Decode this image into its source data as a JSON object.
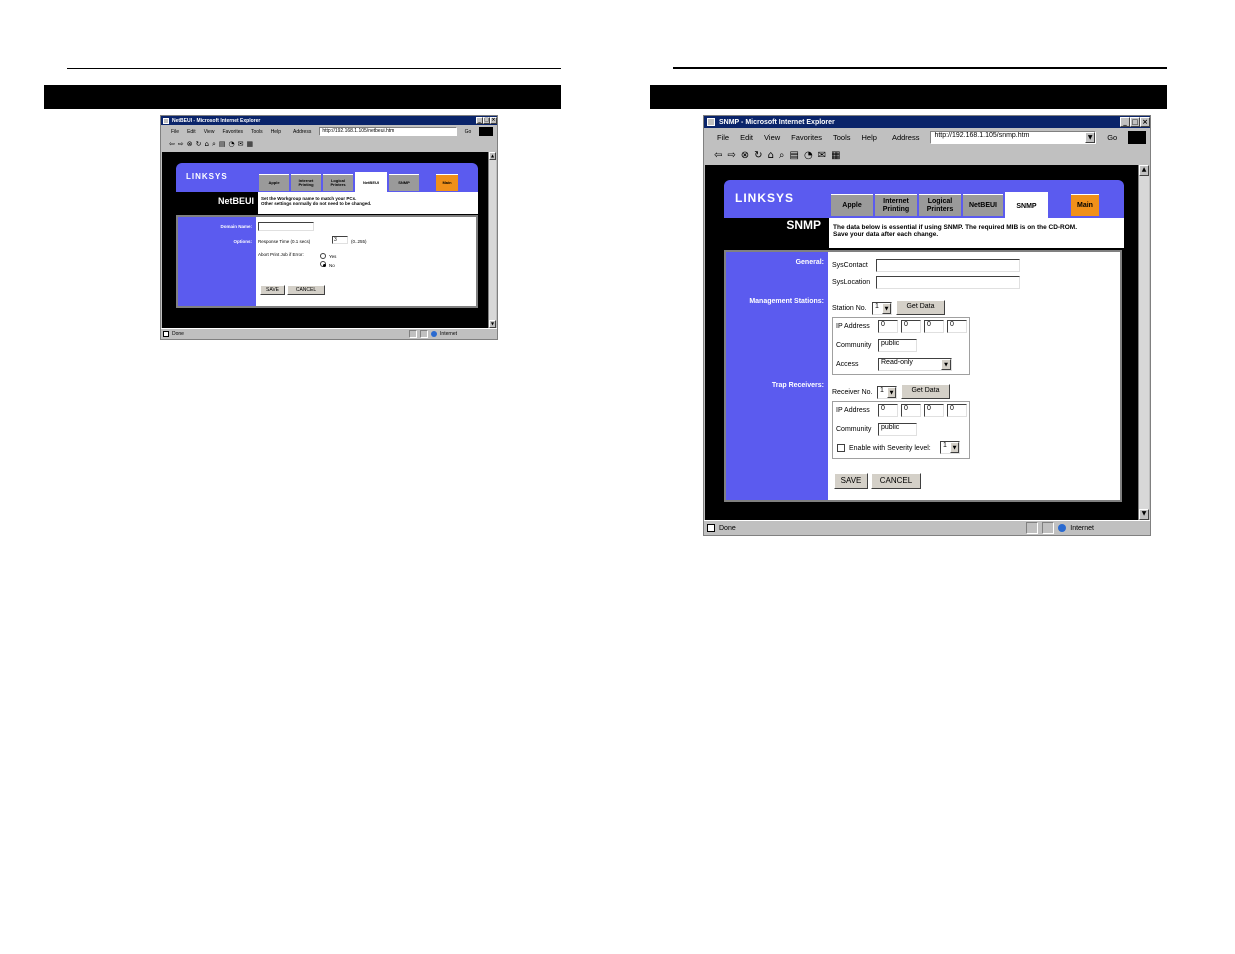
{
  "left": {
    "window": {
      "title": "NetBEUI - Microsoft Internet Explorer",
      "menu": [
        "File",
        "Edit",
        "View",
        "Favorites",
        "Tools",
        "Help"
      ],
      "address_label": "Address",
      "address": "http://192.168.1.105/netbeui.htm",
      "go": "Go",
      "status": "Done",
      "zone": "Internet"
    },
    "page": {
      "logo": "LINKSYS",
      "tabs": [
        "Apple",
        "Internet Printing",
        "Logical Printers",
        "NetBEUI",
        "SNMP",
        "Main"
      ],
      "active_tab": "NetBEUI",
      "section_title": "NetBEUI",
      "info_line1": "Set the Workgroup name to match your PCs.",
      "info_line2": "Other settings normally do not need to be changed.",
      "domain_label": "Domain Name:",
      "domain_value": "",
      "options_label": "Options:",
      "response_label": "Response Time (0.1 secs)",
      "response_value": "3",
      "response_range": "(0..255)",
      "abort_label": "Abort Print Job if Error:",
      "yes": "Yes",
      "no": "No",
      "save": "SAVE",
      "cancel": "CANCEL"
    }
  },
  "right": {
    "window": {
      "title": "SNMP - Microsoft Internet Explorer",
      "menu": [
        "File",
        "Edit",
        "View",
        "Favorites",
        "Tools",
        "Help"
      ],
      "address_label": "Address",
      "address": "http://192.168.1.105/snmp.htm",
      "go": "Go",
      "status": "Done",
      "zone": "Internet"
    },
    "page": {
      "logo": "LINKSYS",
      "tabs": [
        "Apple",
        "Internet Printing",
        "Logical Printers",
        "NetBEUI",
        "SNMP",
        "Main"
      ],
      "active_tab": "SNMP",
      "section_title": "SNMP",
      "info_line1": "The data below is essential if using SNMP. The required MIB is on the CD-ROM.",
      "info_line2": "Save your data after each change.",
      "general_label": "General:",
      "syscontact_label": "SysContact",
      "syscontact_value": "",
      "syslocation_label": "SysLocation",
      "syslocation_value": "",
      "mgmt_label": "Management Stations:",
      "station_label": "Station No.",
      "station_value": "1",
      "get_data": "Get Data",
      "ip_label": "IP Address",
      "station_ip": [
        "0",
        "0",
        "0",
        "0"
      ],
      "community_label": "Community",
      "station_community": "public",
      "access_label": "Access",
      "access_value": "Read-only",
      "trap_label": "Trap Receivers:",
      "receiver_label": "Receiver No.",
      "receiver_value": "1",
      "receiver_ip": [
        "0",
        "0",
        "0",
        "0"
      ],
      "receiver_community": "public",
      "severity_label": "Enable with Severity level:",
      "severity_value": "1",
      "save": "SAVE",
      "cancel": "CANCEL"
    }
  },
  "colors": {
    "header_blue": "#5b5bef",
    "main_tab_orange": "#f0901a",
    "title_bar": "#0a246a"
  }
}
